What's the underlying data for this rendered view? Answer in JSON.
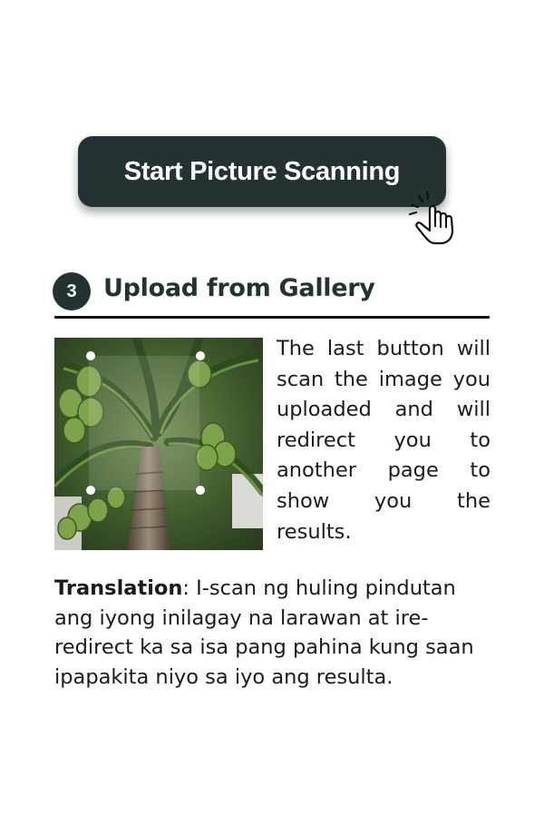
{
  "button": {
    "label": "Start Picture Scanning"
  },
  "step": {
    "number": "3",
    "title": "Upload from Gallery"
  },
  "description": "The last button will scan the image you uploaded and will redirect you to another page to show you the results.",
  "translation": {
    "label": "Translation",
    "separator": ":",
    "text": " I-scan ng huling pindutan ang iyong inilagay na larawan at ire-redirect ka sa isa pang pahina kung saan ipapakita niyo sa iyo ang resulta."
  },
  "icons": {
    "pointer": "pointing-hand-icon"
  },
  "colors": {
    "button_bg": "#253234",
    "button_text": "#ffffff",
    "text": "#1b1b1b"
  }
}
